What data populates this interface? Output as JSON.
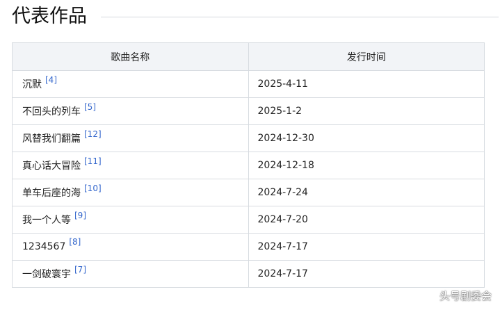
{
  "section": {
    "title": "代表作品"
  },
  "table": {
    "headers": [
      "歌曲名称",
      "发行时间"
    ],
    "rows": [
      {
        "title": "沉默",
        "ref": "[4]",
        "date": "2025-4-11"
      },
      {
        "title": "不回头的列车",
        "ref": "[5]",
        "date": "2025-1-2"
      },
      {
        "title": "风替我们翻篇",
        "ref": "[12]",
        "date": "2024-12-30"
      },
      {
        "title": "真心话大冒险",
        "ref": "[11]",
        "date": "2024-12-18"
      },
      {
        "title": "单车后座的海",
        "ref": "[10]",
        "date": "2024-7-24"
      },
      {
        "title": "我一个人等",
        "ref": "[9]",
        "date": "2024-7-20"
      },
      {
        "title": "1234567",
        "ref": "[8]",
        "date": "2024-7-17"
      },
      {
        "title": "一剑破寰宇",
        "ref": "[7]",
        "date": "2024-7-17"
      }
    ]
  },
  "watermark": {
    "text": "头号剧委会"
  },
  "colors": {
    "link": "#3366cc",
    "header_bg": "#f2f4f7",
    "border": "#d7dbe0"
  }
}
